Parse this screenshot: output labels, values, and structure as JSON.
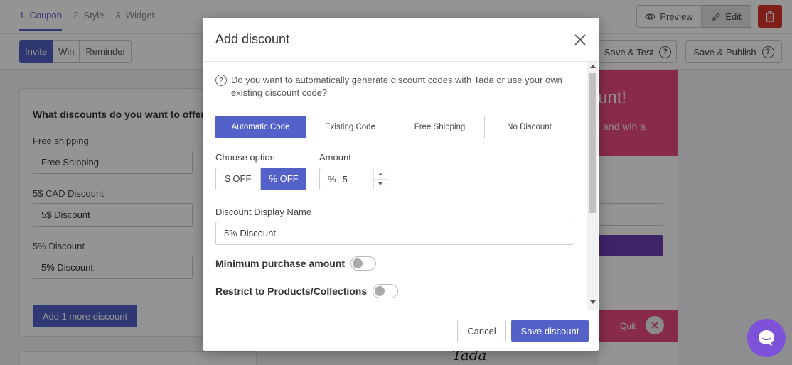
{
  "topbar": {
    "steps": [
      "1. Coupon",
      "2. Style",
      "3. Widget"
    ],
    "preview_label": "Preview",
    "edit_label": "Edit"
  },
  "subbar": {
    "segments": [
      "Invite",
      "Win",
      "Reminder"
    ],
    "save_test_label": "Save & Test",
    "save_publish_label": "Save & Publish"
  },
  "left_panel": {
    "heading": "What discounts do you want to offer?",
    "discounts": [
      {
        "label": "Free shipping",
        "value": "Free Shipping"
      },
      {
        "label": "5$ CAD Discount",
        "value": "5$ Discount"
      },
      {
        "label": "5% Discount",
        "value": "5% Discount"
      }
    ],
    "add_more_label": "Add 1 more discount"
  },
  "preview": {
    "headline_fragment": "unt!",
    "subline_fragment": "l and win a",
    "quit_label": "Quit",
    "brand": "Tada"
  },
  "modal": {
    "title": "Add discount",
    "question": "Do you want to automatically generate discount codes with Tada or use your own existing discount code?",
    "code_types": [
      "Automatic Code",
      "Existing Code",
      "Free Shipping",
      "No Discount"
    ],
    "active_code_type": "Automatic Code",
    "choose_option_label": "Choose option",
    "options": [
      "$ OFF",
      "% OFF"
    ],
    "active_option": "% OFF",
    "amount_label": "Amount",
    "amount_prefix": "%",
    "amount_value": "5",
    "display_name_label": "Discount Display Name",
    "display_name_value": "5% Discount",
    "min_purchase_label": "Minimum purchase amount",
    "min_purchase_enabled": false,
    "restrict_label": "Restrict to Products/Collections",
    "restrict_enabled": false,
    "cancel_label": "Cancel",
    "save_label": "Save discount"
  },
  "colors": {
    "accent": "#5461c8",
    "danger": "#d9362b",
    "pink": "#e84a7f",
    "chat": "#7d52d9"
  }
}
